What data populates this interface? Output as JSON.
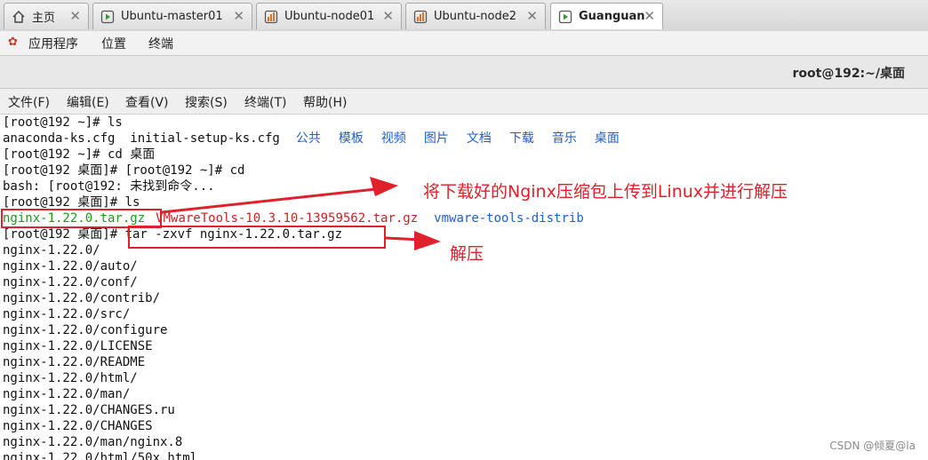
{
  "tabs": [
    {
      "label": "主页",
      "icon": "home-icon"
    },
    {
      "label": "Ubuntu-master01",
      "icon": "vm-icon"
    },
    {
      "label": "Ubuntu-node01",
      "icon": "vm-icon"
    },
    {
      "label": "Ubuntu-node2",
      "icon": "vm-icon"
    },
    {
      "label": "Guanguan",
      "icon": "vm-running-icon"
    }
  ],
  "panel": {
    "apps": "应用程序",
    "places": "位置",
    "terminal": "终端"
  },
  "window_title": "root@192:~/桌面",
  "menu": [
    "文件(F)",
    "编辑(E)",
    "查看(V)",
    "搜索(S)",
    "终端(T)",
    "帮助(H)"
  ],
  "terminal": {
    "l1": "[root@192 ~]# ls",
    "l2_files": "anaconda-ks.cfg  initial-setup-ks.cfg",
    "l2_dirs": [
      "公共",
      "模板",
      "视频",
      "图片",
      "文档",
      "下载",
      "音乐",
      "桌面"
    ],
    "l3": "[root@192 ~]# cd 桌面",
    "l4": "[root@192 桌面]# [root@192 ~]# cd",
    "l5": "bash: [root@192: 未找到命令...",
    "l6": "[root@192 桌面]# ls",
    "l7_a": "nginx-1.22.0.tar.gz",
    "l7_b": "VMwareTools-10.3.10-13959562.tar.gz",
    "l7_c": "vmware-tools-distrib",
    "l8_prompt": "[root@192 桌面]# ",
    "l8_cmd": "tar -zxvf nginx-1.22.0.tar.gz",
    "output": [
      "nginx-1.22.0/",
      "nginx-1.22.0/auto/",
      "nginx-1.22.0/conf/",
      "nginx-1.22.0/contrib/",
      "nginx-1.22.0/src/",
      "nginx-1.22.0/configure",
      "nginx-1.22.0/LICENSE",
      "nginx-1.22.0/README",
      "nginx-1.22.0/html/",
      "nginx-1.22.0/man/",
      "nginx-1.22.0/CHANGES.ru",
      "nginx-1.22.0/CHANGES",
      "nginx-1.22.0/man/nginx.8",
      "nginx-1.22.0/html/50x.html"
    ]
  },
  "annotations": {
    "upload_note": "将下载好的Nginx压缩包上传到Linux并进行解压",
    "extract_note": "解压"
  },
  "watermark": "CSDN @倾夏@la",
  "colors": {
    "annotation": "#e0202a",
    "dir_blue": "#1f5fd0",
    "archive_red": "#cc2222",
    "archive_green": "#1b9a1b"
  }
}
